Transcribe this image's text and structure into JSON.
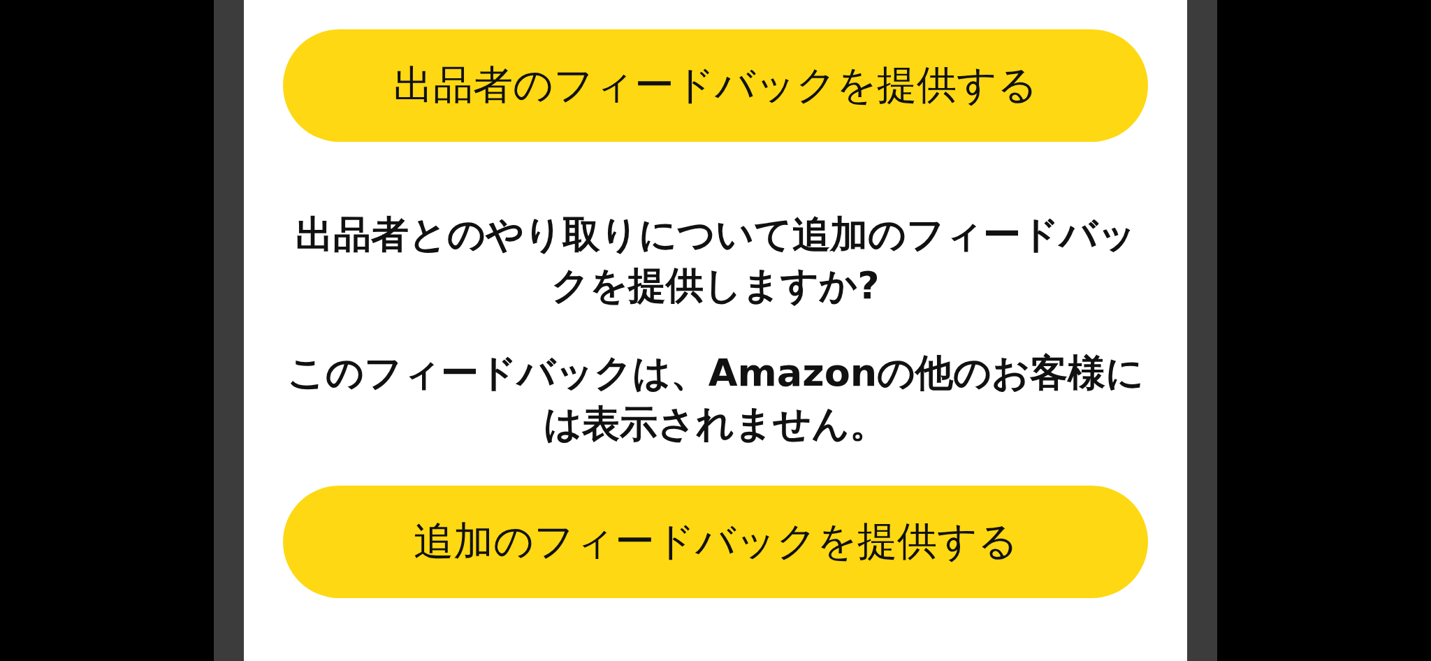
{
  "seller_feedback_button": {
    "label": "出品者のフィードバックを提供する"
  },
  "prompt": {
    "paragraphs": [
      "出品者とのやり取りについて追加のフィードバックを提供しますか?",
      "このフィードバックは、Amazonの他のお客様には表示されません。"
    ]
  },
  "additional_feedback_button": {
    "label": "追加のフィードバックを提供する"
  }
}
